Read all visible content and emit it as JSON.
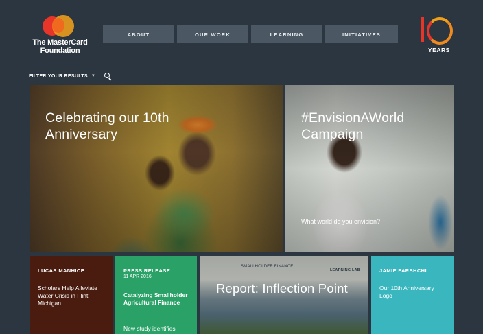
{
  "brand": {
    "name_line1": "The MasterCard",
    "name_line2": "Foundation",
    "colors": {
      "red": "#e8352a",
      "orange": "#f7a21b",
      "background": "#2c3640"
    }
  },
  "nav": {
    "items": [
      {
        "label": "ABOUT"
      },
      {
        "label": "OUR WORK"
      },
      {
        "label": "LEARNING"
      },
      {
        "label": "INITIATIVES"
      }
    ]
  },
  "anniversary_badge": {
    "years_label": "YEARS"
  },
  "filter": {
    "label": "FILTER YOUR RESULTS",
    "caret": "▼",
    "search_icon": "search-icon"
  },
  "tiles": {
    "anniversary": {
      "title": "Celebrating our 10th Anniversary"
    },
    "envision": {
      "title": "#EnvisionAWorld Campaign",
      "subtitle": "What world do you envision?"
    },
    "lucas": {
      "author": "LUCAS MANHICE",
      "body": "Scholars Help Alleviate Water Crisis in Flint, Michigan"
    },
    "press": {
      "tag": "PRESS RELEASE",
      "date": "11 APR 2016",
      "body": "Catalyzing Smallholder Agricultural Finance",
      "more": "New study identifies"
    },
    "report": {
      "title": "Report: Inflection Point",
      "banner_left": "SMALLHOLDER FINANCE",
      "banner_right": "LEARNING LAB"
    },
    "jamie": {
      "author": "JAMIE FARSHCHI",
      "body": "Our 10th Anniversary Logo"
    }
  }
}
